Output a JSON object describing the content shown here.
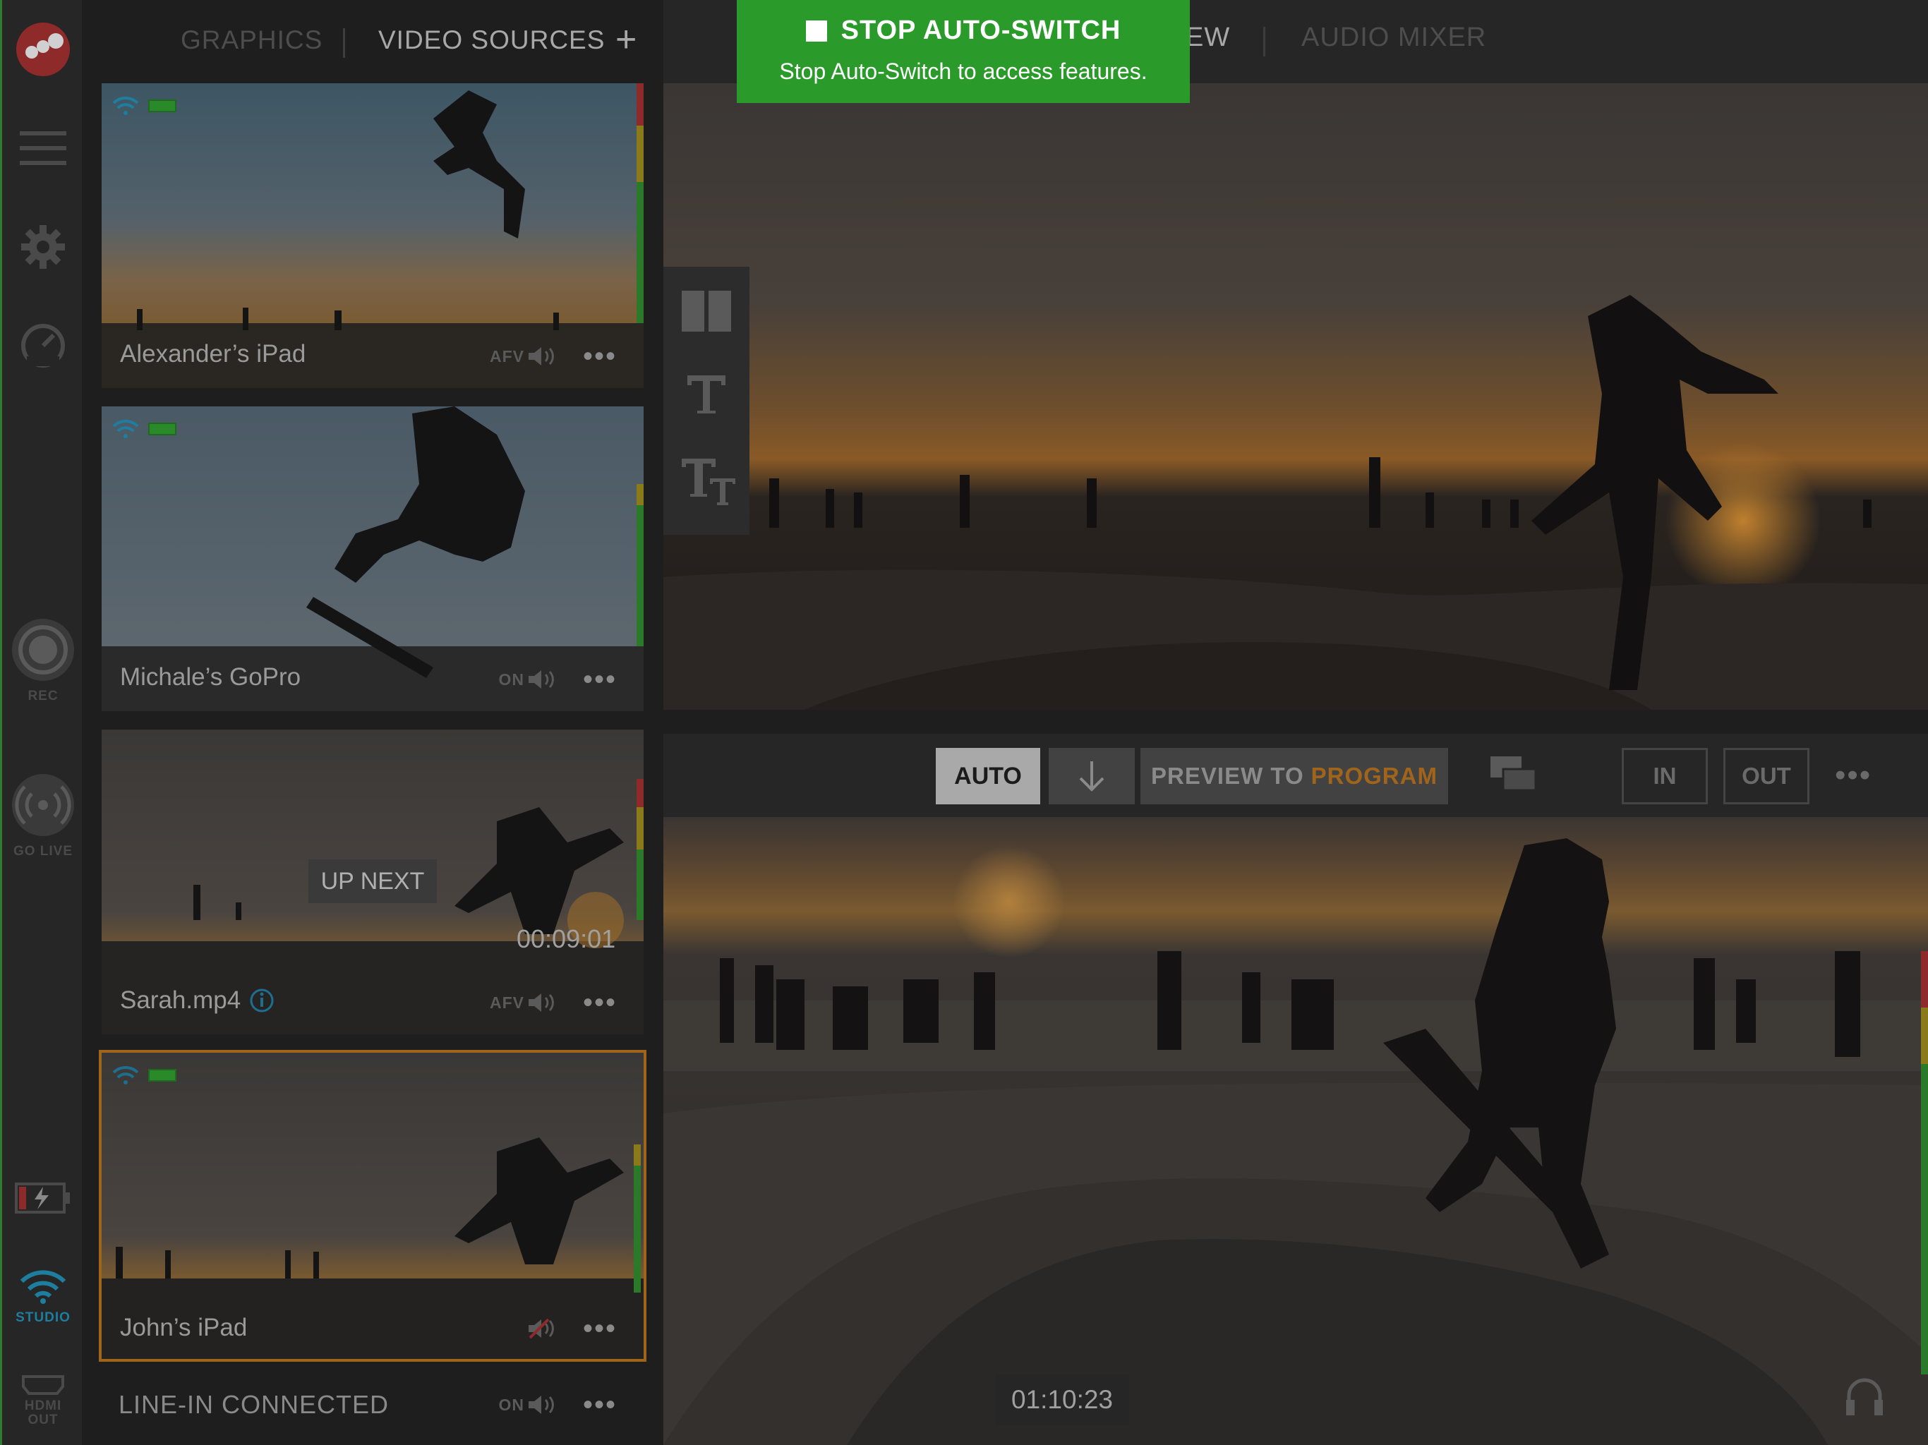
{
  "app": {
    "accent_green": "#2a9a2a",
    "accent_orange": "#a0651a",
    "brand_red": "#c0392b"
  },
  "rail": {
    "rec_label": "REC",
    "golive_label": "GO LIVE",
    "studio_label": "STUDIO",
    "hdmi_label_1": "HDMI",
    "hdmi_label_2": "OUT"
  },
  "tabs_left": {
    "graphics": "GRAPHICS",
    "video_sources": "VIDEO SOURCES",
    "add": "+"
  },
  "tabs_right": {
    "preview_partial": "EW",
    "audio_mixer": "AUDIO MIXER"
  },
  "banner": {
    "title": "STOP AUTO-SWITCH",
    "subtitle": "Stop Auto-Switch to access features."
  },
  "sources": [
    {
      "name": "Alexander’s iPad",
      "ctl": "AFV",
      "more": "•••"
    },
    {
      "name": "Michale’s GoPro",
      "ctl": "ON",
      "more": "•••"
    },
    {
      "name": "Sarah.mp4",
      "ctl": "AFV",
      "more": "•••",
      "timecode": "00:09:01",
      "badge": "UP NEXT"
    },
    {
      "name": "John’s iPad",
      "ctl": "",
      "more": "•••"
    }
  ],
  "line_in": {
    "label": "LINE-IN CONNECTED",
    "ctl": "ON",
    "more": "•••"
  },
  "controls": {
    "auto": "AUTO",
    "preview_to": "PREVIEW TO",
    "program": "PROGRAM",
    "in": "IN",
    "out": "OUT",
    "more": "•••"
  },
  "program": {
    "timecode": "01:10:23"
  }
}
